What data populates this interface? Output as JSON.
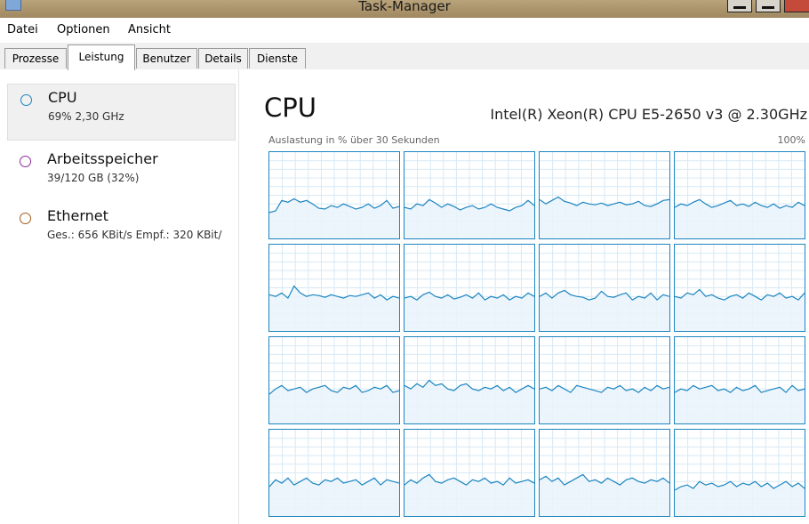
{
  "window": {
    "title": "Task-Manager",
    "close_color": "#c44a3a"
  },
  "menu": {
    "items": [
      "Datei",
      "Optionen",
      "Ansicht"
    ]
  },
  "tabs": [
    "Prozesse",
    "Leistung",
    "Benutzer",
    "Details",
    "Dienste"
  ],
  "active_tab": "Leistung",
  "sidebar": {
    "items": [
      {
        "name": "CPU",
        "detail": "69% 2,30 GHz",
        "color": "#1c85c0"
      },
      {
        "name": "Arbeitsspeicher",
        "detail": "39/120 GB (32%)",
        "color": "#8b2c9e"
      },
      {
        "name": "Ethernet",
        "detail": "Ges.: 656 KBit/s Empf.: 320 KBit/",
        "color": "#a55a1a"
      }
    ]
  },
  "main": {
    "title": "CPU",
    "cpu_model": "Intel(R) Xeon(R) CPU E5-2650 v3 @ 2.30GHz",
    "graph_label": "Auslastung in % über 30 Sekunden",
    "graph_max": "100%",
    "graph_color": "#1c85c0",
    "graph_fill": "#eaf3fb",
    "grid_color": "#d7e9f5"
  },
  "cores": [
    [
      30,
      32,
      44,
      42,
      46,
      42,
      44,
      40,
      35,
      34,
      38,
      36,
      40,
      37,
      34,
      36,
      40,
      35,
      38,
      44,
      35,
      37
    ],
    [
      36,
      34,
      40,
      38,
      45,
      41,
      36,
      40,
      37,
      33,
      36,
      38,
      34,
      36,
      40,
      36,
      34,
      32,
      36,
      38,
      44,
      38
    ],
    [
      45,
      40,
      44,
      48,
      43,
      41,
      38,
      42,
      40,
      39,
      41,
      38,
      40,
      42,
      39,
      40,
      43,
      38,
      37,
      40,
      44,
      45
    ],
    [
      36,
      40,
      38,
      42,
      45,
      40,
      36,
      38,
      41,
      44,
      38,
      40,
      37,
      42,
      38,
      36,
      40,
      35,
      38,
      36,
      42,
      38
    ],
    [
      42,
      40,
      44,
      38,
      52,
      44,
      40,
      42,
      41,
      39,
      42,
      40,
      38,
      41,
      40,
      42,
      44,
      38,
      42,
      36,
      40,
      38
    ],
    [
      38,
      40,
      36,
      42,
      45,
      40,
      38,
      42,
      37,
      39,
      42,
      38,
      44,
      36,
      40,
      38,
      42,
      36,
      40,
      38,
      44,
      40
    ],
    [
      40,
      44,
      38,
      44,
      47,
      42,
      40,
      39,
      36,
      38,
      46,
      40,
      39,
      42,
      44,
      36,
      40,
      38,
      44,
      36,
      42,
      40
    ],
    [
      40,
      38,
      44,
      42,
      48,
      40,
      42,
      38,
      36,
      40,
      42,
      38,
      44,
      40,
      36,
      42,
      40,
      44,
      38,
      40,
      36,
      44
    ],
    [
      34,
      40,
      44,
      38,
      40,
      42,
      36,
      40,
      42,
      44,
      38,
      36,
      42,
      40,
      44,
      36,
      38,
      42,
      40,
      44,
      36,
      38
    ],
    [
      44,
      40,
      46,
      42,
      50,
      44,
      46,
      40,
      38,
      44,
      46,
      40,
      38,
      42,
      40,
      44,
      38,
      42,
      36,
      40,
      44,
      40
    ],
    [
      40,
      42,
      38,
      44,
      40,
      36,
      44,
      42,
      40,
      38,
      36,
      42,
      40,
      44,
      38,
      40,
      36,
      42,
      38,
      44,
      40,
      42
    ],
    [
      36,
      40,
      38,
      44,
      40,
      42,
      44,
      38,
      40,
      36,
      42,
      38,
      40,
      44,
      36,
      38,
      40,
      42,
      36,
      44,
      38,
      40
    ],
    [
      34,
      42,
      38,
      44,
      36,
      40,
      44,
      38,
      36,
      42,
      40,
      44,
      38,
      40,
      42,
      36,
      40,
      44,
      36,
      42,
      40,
      38
    ],
    [
      36,
      42,
      38,
      44,
      48,
      40,
      38,
      42,
      44,
      40,
      36,
      42,
      40,
      44,
      38,
      40,
      36,
      44,
      38,
      40,
      42,
      38
    ],
    [
      42,
      46,
      40,
      44,
      36,
      40,
      44,
      48,
      40,
      42,
      38,
      44,
      40,
      36,
      42,
      44,
      40,
      38,
      42,
      40,
      44,
      38
    ],
    [
      30,
      34,
      36,
      32,
      40,
      36,
      38,
      34,
      36,
      40,
      34,
      38,
      36,
      40,
      34,
      38,
      32,
      36,
      40,
      34,
      38,
      32
    ]
  ]
}
